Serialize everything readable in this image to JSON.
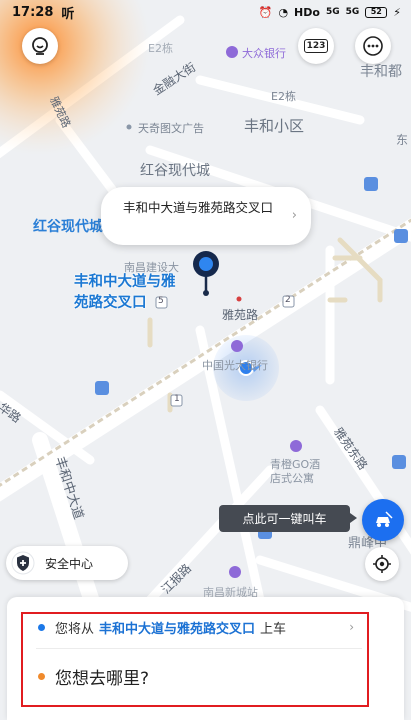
{
  "status_bar": {
    "time": "17:28",
    "carrier_icon": "听",
    "network": "HDo",
    "signal1": "5G",
    "signal2": "5G",
    "battery": "52"
  },
  "top_buttons": {
    "left_icon": "chat-bubble-icon",
    "keyboard_label": "123",
    "more_icon": "more-dots-icon"
  },
  "map": {
    "labels": {
      "jinrong": "金融大街",
      "dazhong": "大众银行",
      "fenghedu": "丰和都",
      "e2": "E2栋",
      "e2b": "E2栋",
      "yayuan_road": "雅苑路",
      "tianqi": "天奇图文广告",
      "fenghe_xiaoqu": "丰和小区",
      "honggu1": "红谷现代城",
      "honggu2": "红谷现代城",
      "nanchang_bank": "南昌建设大",
      "yayuan_road2": "雅苑路",
      "bank": "中国光大银行",
      "road_bottom_left": "华路",
      "fenghe_zhong": "丰和中大道",
      "yayuan_east": "雅苑东路",
      "qingcheng": "青橙GO酒店式公寓",
      "dingfeng": "鼎峰中",
      "jiangnan": "江报路",
      "bottom_partial": "南昌新城站",
      "dong": "东",
      "num5": "5",
      "num2": "2",
      "num1": "1"
    },
    "location_bubble": "丰和中大道与雅苑路交叉口",
    "pickup_label": "丰和中大道与雅苑路交叉口"
  },
  "call_car": {
    "tooltip": "点此可一键叫车",
    "button_icon": "car-icon"
  },
  "safety_center": {
    "label": "安全中心"
  },
  "bottom_sheet": {
    "pickup_prefix": "您将从",
    "pickup_address": "丰和中大道与雅苑路交叉口",
    "pickup_suffix": "上车",
    "destination_placeholder": "您想去哪里?"
  },
  "colors": {
    "accent_blue": "#1c72d4",
    "origin_dot": "#1c78e8",
    "dest_dot": "#f08a2c",
    "highlight_red": "#e11c20",
    "corner_glow": "#ff8a1e"
  }
}
